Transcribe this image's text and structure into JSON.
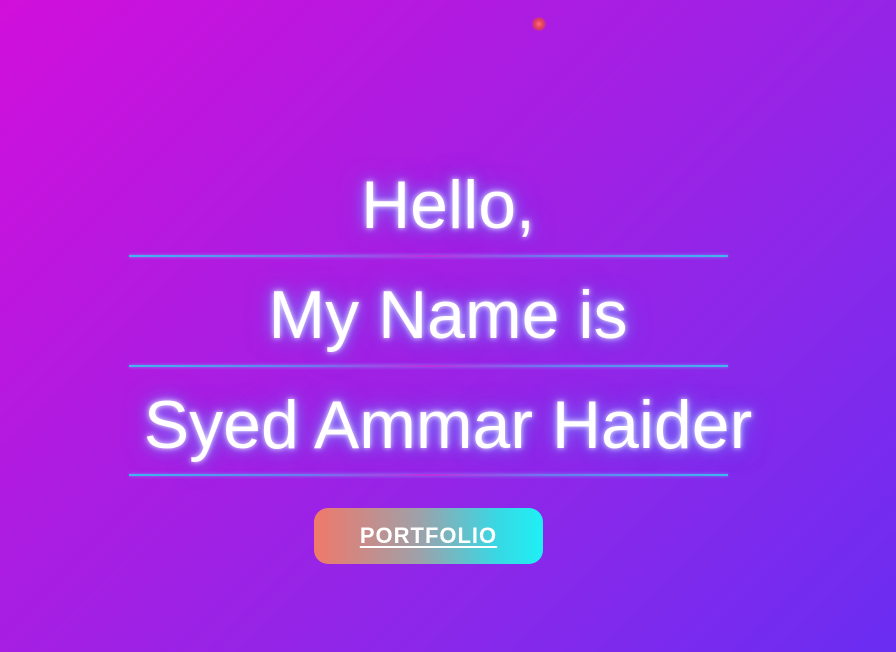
{
  "hero": {
    "line1": "Hello,",
    "line2": "My Name is",
    "line3": "Syed Ammar Haider"
  },
  "button": {
    "label": "PORTFOLIO"
  },
  "colors": {
    "background_start": "#d10fdb",
    "background_end": "#6a2df2",
    "text": "#ffffff",
    "glow": "#6a7aff",
    "button_start": "#f0786a",
    "button_end": "#1ef0f4",
    "divider": "#3fb6f0"
  }
}
